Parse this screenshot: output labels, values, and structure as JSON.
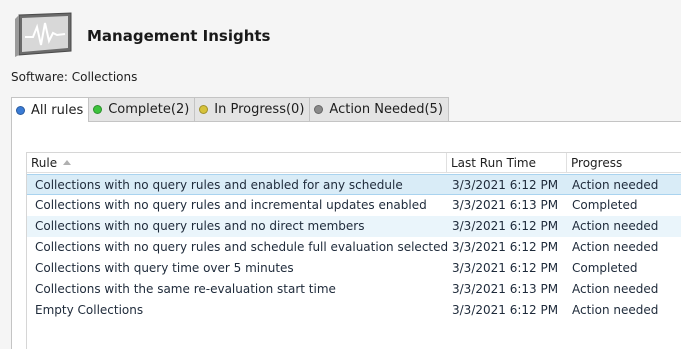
{
  "header": {
    "title": "Management Insights",
    "breadcrumb": "Software: Collections"
  },
  "tabs": [
    {
      "label": "All rules",
      "color": "#3a7bd5",
      "active": true
    },
    {
      "label": "Complete(2)",
      "color": "#3cc23c",
      "active": false
    },
    {
      "label": "In Progress(0)",
      "color": "#d6c23a",
      "active": false
    },
    {
      "label": "Action Needed(5)",
      "color": "#8a8a8a",
      "active": false
    }
  ],
  "table": {
    "columns": {
      "rule": "Rule",
      "last_run": "Last Run Time",
      "progress": "Progress"
    },
    "rows": [
      {
        "rule": "Collections with no query rules and enabled for any schedule",
        "last_run": "3/3/2021 6:12 PM",
        "progress": "Action needed"
      },
      {
        "rule": "Collections with no query rules and incremental updates enabled",
        "last_run": "3/3/2021 6:13 PM",
        "progress": "Completed"
      },
      {
        "rule": "Collections with no query rules and no direct members",
        "last_run": "3/3/2021 6:12 PM",
        "progress": "Action needed"
      },
      {
        "rule": "Collections with no query rules and schedule full evaluation selected",
        "last_run": "3/3/2021 6:12 PM",
        "progress": "Action needed"
      },
      {
        "rule": "Collections with query time over 5 minutes",
        "last_run": "3/3/2021 6:12 PM",
        "progress": "Completed"
      },
      {
        "rule": "Collections with the same re-evaluation start time",
        "last_run": "3/3/2021 6:13 PM",
        "progress": "Action needed"
      },
      {
        "rule": "Empty Collections",
        "last_run": "3/3/2021 6:12 PM",
        "progress": "Action needed"
      }
    ]
  },
  "colors": {
    "selected_row": "#d9ecf7",
    "hover_row": "#eaf5fb"
  }
}
